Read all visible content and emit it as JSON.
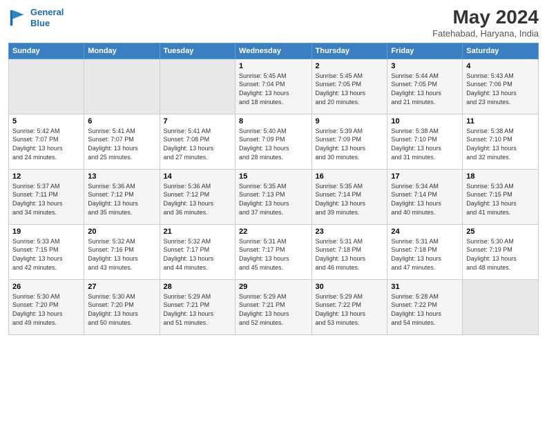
{
  "header": {
    "logo_line1": "General",
    "logo_line2": "Blue",
    "month_year": "May 2024",
    "location": "Fatehabad, Haryana, India"
  },
  "weekdays": [
    "Sunday",
    "Monday",
    "Tuesday",
    "Wednesday",
    "Thursday",
    "Friday",
    "Saturday"
  ],
  "weeks": [
    [
      {
        "day": "",
        "info": ""
      },
      {
        "day": "",
        "info": ""
      },
      {
        "day": "",
        "info": ""
      },
      {
        "day": "1",
        "info": "Sunrise: 5:45 AM\nSunset: 7:04 PM\nDaylight: 13 hours\nand 18 minutes."
      },
      {
        "day": "2",
        "info": "Sunrise: 5:45 AM\nSunset: 7:05 PM\nDaylight: 13 hours\nand 20 minutes."
      },
      {
        "day": "3",
        "info": "Sunrise: 5:44 AM\nSunset: 7:05 PM\nDaylight: 13 hours\nand 21 minutes."
      },
      {
        "day": "4",
        "info": "Sunrise: 5:43 AM\nSunset: 7:06 PM\nDaylight: 13 hours\nand 23 minutes."
      }
    ],
    [
      {
        "day": "5",
        "info": "Sunrise: 5:42 AM\nSunset: 7:07 PM\nDaylight: 13 hours\nand 24 minutes."
      },
      {
        "day": "6",
        "info": "Sunrise: 5:41 AM\nSunset: 7:07 PM\nDaylight: 13 hours\nand 25 minutes."
      },
      {
        "day": "7",
        "info": "Sunrise: 5:41 AM\nSunset: 7:08 PM\nDaylight: 13 hours\nand 27 minutes."
      },
      {
        "day": "8",
        "info": "Sunrise: 5:40 AM\nSunset: 7:09 PM\nDaylight: 13 hours\nand 28 minutes."
      },
      {
        "day": "9",
        "info": "Sunrise: 5:39 AM\nSunset: 7:09 PM\nDaylight: 13 hours\nand 30 minutes."
      },
      {
        "day": "10",
        "info": "Sunrise: 5:38 AM\nSunset: 7:10 PM\nDaylight: 13 hours\nand 31 minutes."
      },
      {
        "day": "11",
        "info": "Sunrise: 5:38 AM\nSunset: 7:10 PM\nDaylight: 13 hours\nand 32 minutes."
      }
    ],
    [
      {
        "day": "12",
        "info": "Sunrise: 5:37 AM\nSunset: 7:11 PM\nDaylight: 13 hours\nand 34 minutes."
      },
      {
        "day": "13",
        "info": "Sunrise: 5:36 AM\nSunset: 7:12 PM\nDaylight: 13 hours\nand 35 minutes."
      },
      {
        "day": "14",
        "info": "Sunrise: 5:36 AM\nSunset: 7:12 PM\nDaylight: 13 hours\nand 36 minutes."
      },
      {
        "day": "15",
        "info": "Sunrise: 5:35 AM\nSunset: 7:13 PM\nDaylight: 13 hours\nand 37 minutes."
      },
      {
        "day": "16",
        "info": "Sunrise: 5:35 AM\nSunset: 7:14 PM\nDaylight: 13 hours\nand 39 minutes."
      },
      {
        "day": "17",
        "info": "Sunrise: 5:34 AM\nSunset: 7:14 PM\nDaylight: 13 hours\nand 40 minutes."
      },
      {
        "day": "18",
        "info": "Sunrise: 5:33 AM\nSunset: 7:15 PM\nDaylight: 13 hours\nand 41 minutes."
      }
    ],
    [
      {
        "day": "19",
        "info": "Sunrise: 5:33 AM\nSunset: 7:15 PM\nDaylight: 13 hours\nand 42 minutes."
      },
      {
        "day": "20",
        "info": "Sunrise: 5:32 AM\nSunset: 7:16 PM\nDaylight: 13 hours\nand 43 minutes."
      },
      {
        "day": "21",
        "info": "Sunrise: 5:32 AM\nSunset: 7:17 PM\nDaylight: 13 hours\nand 44 minutes."
      },
      {
        "day": "22",
        "info": "Sunrise: 5:31 AM\nSunset: 7:17 PM\nDaylight: 13 hours\nand 45 minutes."
      },
      {
        "day": "23",
        "info": "Sunrise: 5:31 AM\nSunset: 7:18 PM\nDaylight: 13 hours\nand 46 minutes."
      },
      {
        "day": "24",
        "info": "Sunrise: 5:31 AM\nSunset: 7:18 PM\nDaylight: 13 hours\nand 47 minutes."
      },
      {
        "day": "25",
        "info": "Sunrise: 5:30 AM\nSunset: 7:19 PM\nDaylight: 13 hours\nand 48 minutes."
      }
    ],
    [
      {
        "day": "26",
        "info": "Sunrise: 5:30 AM\nSunset: 7:20 PM\nDaylight: 13 hours\nand 49 minutes."
      },
      {
        "day": "27",
        "info": "Sunrise: 5:30 AM\nSunset: 7:20 PM\nDaylight: 13 hours\nand 50 minutes."
      },
      {
        "day": "28",
        "info": "Sunrise: 5:29 AM\nSunset: 7:21 PM\nDaylight: 13 hours\nand 51 minutes."
      },
      {
        "day": "29",
        "info": "Sunrise: 5:29 AM\nSunset: 7:21 PM\nDaylight: 13 hours\nand 52 minutes."
      },
      {
        "day": "30",
        "info": "Sunrise: 5:29 AM\nSunset: 7:22 PM\nDaylight: 13 hours\nand 53 minutes."
      },
      {
        "day": "31",
        "info": "Sunrise: 5:28 AM\nSunset: 7:22 PM\nDaylight: 13 hours\nand 54 minutes."
      },
      {
        "day": "",
        "info": ""
      }
    ]
  ]
}
